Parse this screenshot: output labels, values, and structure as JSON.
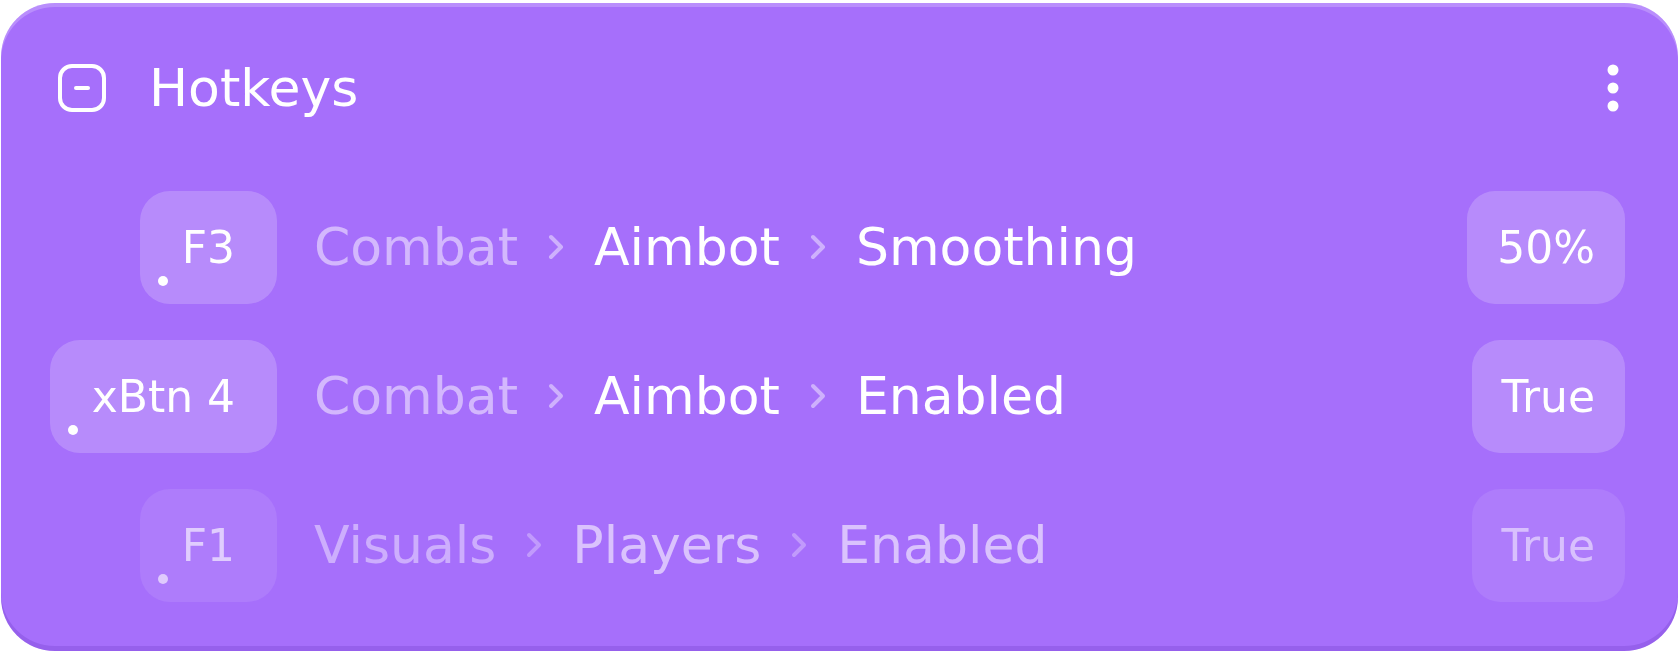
{
  "panel": {
    "title": "Hotkeys"
  },
  "hotkeys": [
    {
      "key": "F3",
      "path": [
        "Combat",
        "Aimbot",
        "Smoothing"
      ],
      "value": "50%",
      "disabled": false
    },
    {
      "key": "xBtn 4",
      "path": [
        "Combat",
        "Aimbot",
        "Enabled"
      ],
      "value": "True",
      "disabled": false
    },
    {
      "key": "F1",
      "path": [
        "Visuals",
        "Players",
        "Enabled"
      ],
      "value": "True",
      "disabled": true
    }
  ]
}
